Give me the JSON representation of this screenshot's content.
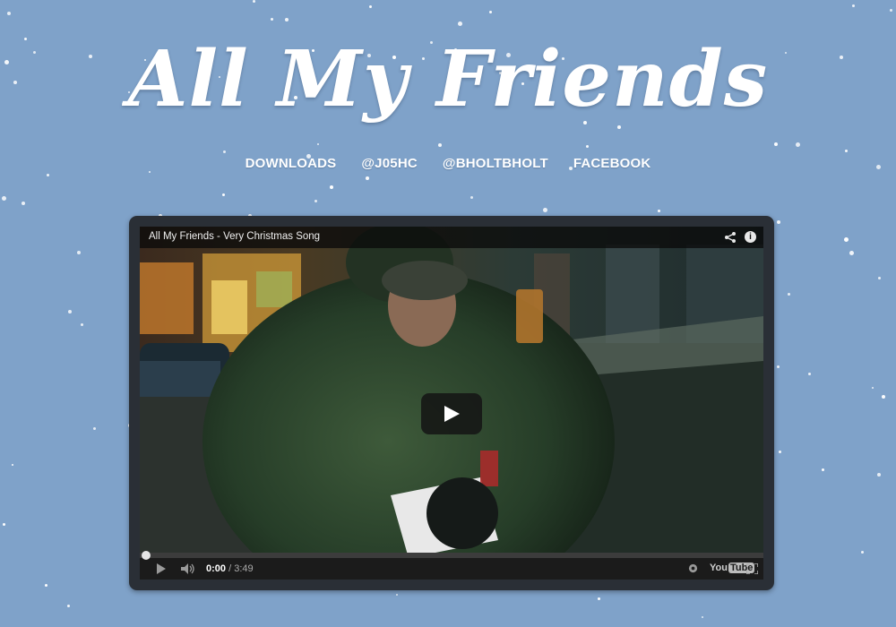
{
  "site": {
    "title": "All My Friends"
  },
  "nav": {
    "items": [
      {
        "label": "DOWNLOADS"
      },
      {
        "label": "@J05HC"
      },
      {
        "label": "@BHOLTBHOLT"
      },
      {
        "label": "FACEBOOK"
      }
    ]
  },
  "player": {
    "title": "All My Friends - Very Christmas Song",
    "time_current": "0:00",
    "time_separator": " / ",
    "time_total": "3:49",
    "progress_fraction": 0,
    "logo_you": "You",
    "logo_tube": "Tube",
    "icons": [
      "share-icon",
      "info-icon",
      "play-icon",
      "volume-icon",
      "settings-icon",
      "fullscreen-icon"
    ]
  },
  "colors": {
    "background": "#7fa2c9",
    "frame": "#2a2f36",
    "text": "#ffffff"
  }
}
